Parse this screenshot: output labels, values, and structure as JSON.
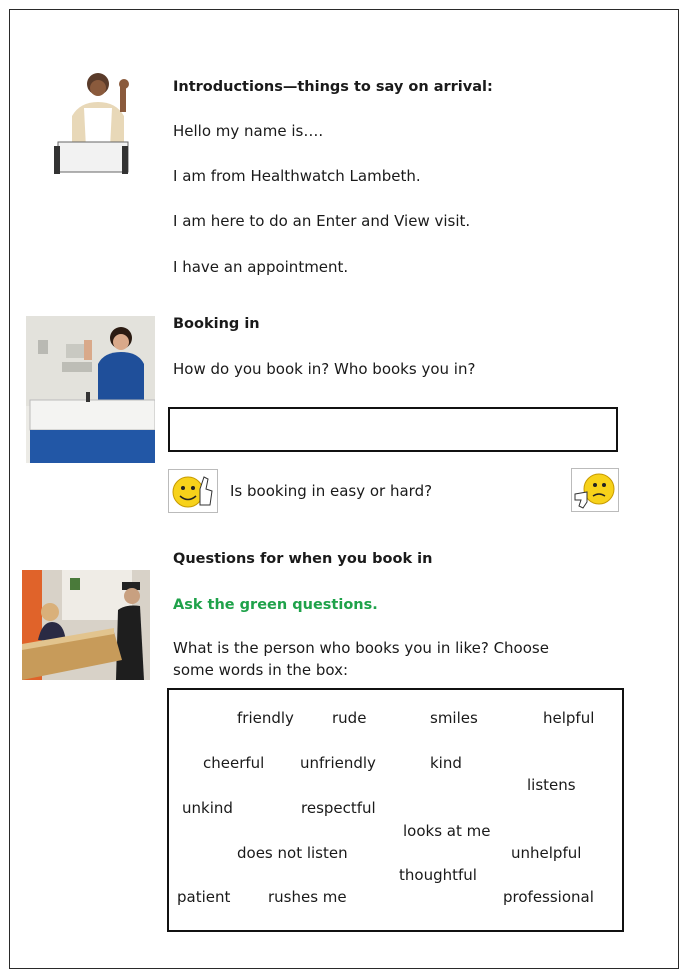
{
  "intro": {
    "heading": "Introductions—things to say on arrival:",
    "lines": [
      "Hello my name is….",
      "I am from Healthwatch Lambeth.",
      "I am here to do an Enter and View visit.",
      "I have an appointment."
    ]
  },
  "booking": {
    "heading": "Booking in",
    "question": "How do you book in?  Who books you in?",
    "easy_hard": "Is booking in easy or hard?"
  },
  "questions": {
    "heading": "Questions for when you book in",
    "green_prompt": "Ask the green questions.",
    "prompt_line1": "What is the person who books you in like?  Choose",
    "prompt_line2": "some words in the box:"
  },
  "words": [
    "friendly",
    "rude",
    "smiles",
    "helpful",
    "cheerful",
    "unfriendly",
    "kind",
    "listens",
    "unkind",
    "respectful",
    "looks at me",
    "does not listen",
    "unhelpful",
    "thoughtful",
    "patient",
    "rushes me",
    "professional"
  ],
  "colors": {
    "green_text": "#1fa24a",
    "uniform_blue": "#1f4f9a",
    "emoji_yellow": "#f7d21a"
  }
}
